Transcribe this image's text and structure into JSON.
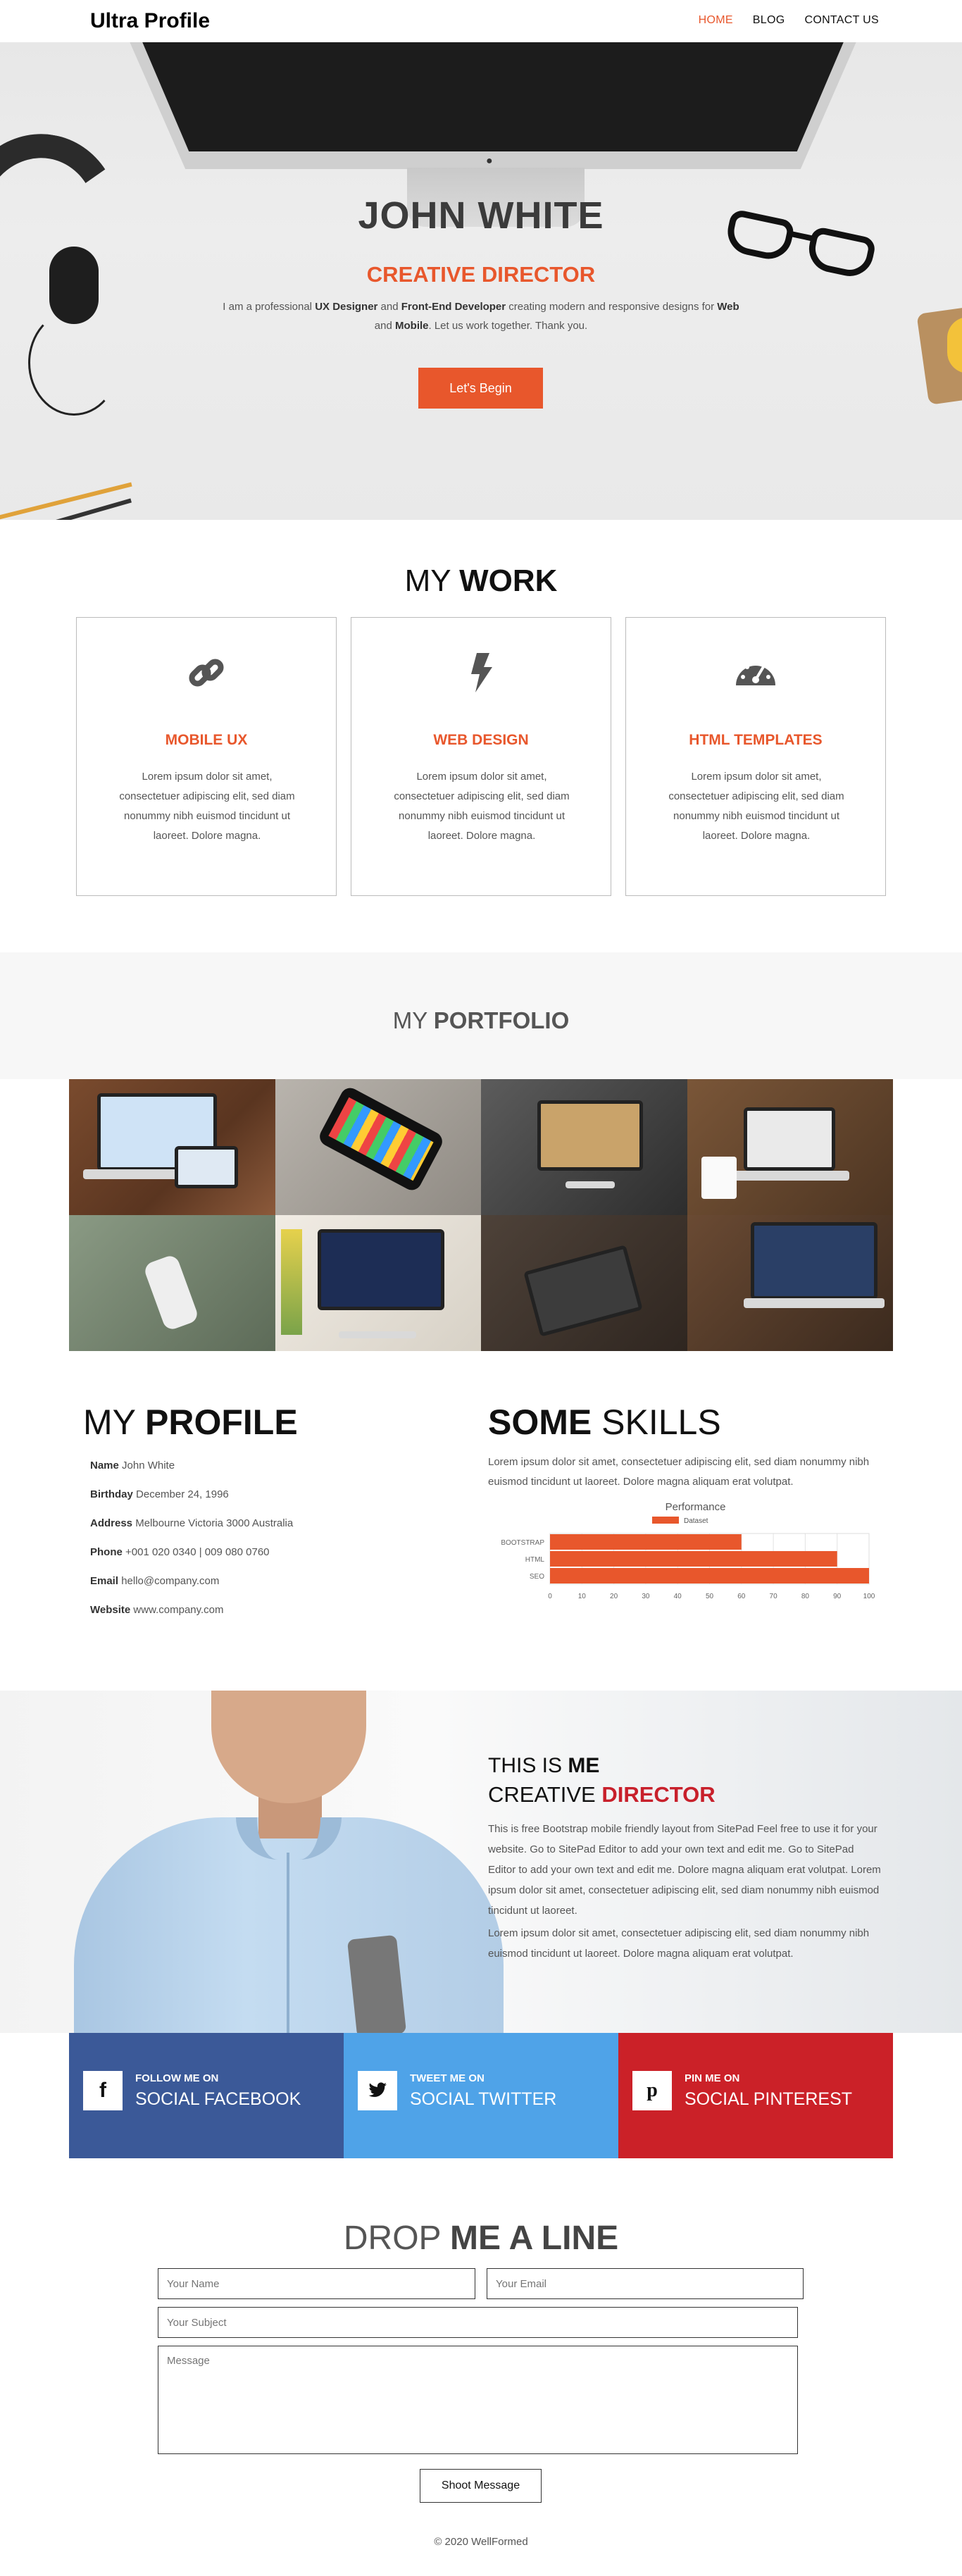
{
  "nav": {
    "brand": "Ultra Profile",
    "items": [
      {
        "label": "HOME",
        "active": true
      },
      {
        "label": "BLOG",
        "active": false
      },
      {
        "label": "CONTACT US",
        "active": false
      }
    ]
  },
  "hero": {
    "name": "JOHN WHITE",
    "role": "CREATIVE DIRECTOR",
    "desc": {
      "p1": "I am a professional ",
      "b1": "UX Designer",
      "p2": " and ",
      "b2": "Front-End Developer",
      "p3": " creating modern and responsive designs for ",
      "b3": "Web",
      "p4": " and ",
      "b4": "Mobile",
      "p5": ". Let us work together. Thank you."
    },
    "button": "Let's Begin"
  },
  "work": {
    "title_light": "MY ",
    "title_bold": "WORK",
    "cards": [
      {
        "icon": "link-icon",
        "title": "MOBILE UX",
        "text": "Lorem ipsum dolor sit amet, consectetuer adipiscing elit, sed diam nonummy nibh euismod tincidunt ut laoreet. Dolore magna."
      },
      {
        "icon": "bolt-icon",
        "title": "WEB DESIGN",
        "text": "Lorem ipsum dolor sit amet, consectetuer adipiscing elit, sed diam nonummy nibh euismod tincidunt ut laoreet. Dolore magna."
      },
      {
        "icon": "dashboard-icon",
        "title": "HTML TEMPLATES",
        "text": "Lorem ipsum dolor sit amet, consectetuer adipiscing elit, sed diam nonummy nibh euismod tincidunt ut laoreet. Dolore magna."
      }
    ]
  },
  "portfolio": {
    "title_light": "MY ",
    "title_bold": "PORTFOLIO"
  },
  "profile": {
    "title_light": "MY ",
    "title_bold": "PROFILE",
    "rows": [
      {
        "label": "Name",
        "value": "John White"
      },
      {
        "label": "Birthday",
        "value": "December 24, 1996"
      },
      {
        "label": "Address",
        "value": "Melbourne Victoria 3000 Australia"
      },
      {
        "label": "Phone",
        "value": "+001 020 0340 | 009 080 0760"
      },
      {
        "label": "Email",
        "value": "hello@company.com"
      },
      {
        "label": "Website",
        "value": "www.company.com"
      }
    ]
  },
  "skills": {
    "title_bold": "SOME",
    "title_light": " SKILLS",
    "desc": "Lorem ipsum dolor sit amet, consectetuer adipiscing elit, sed diam nonummy nibh euismod tincidunt ut laoreet. Dolore magna aliquam erat volutpat."
  },
  "chart_data": {
    "type": "bar",
    "orientation": "horizontal",
    "title": "Performance",
    "categories": [
      "BOOTSTRAP",
      "HTML",
      "SEO"
    ],
    "series": [
      {
        "name": "Dataset",
        "values": [
          60,
          90,
          100
        ]
      }
    ],
    "xlim": [
      0,
      100
    ],
    "xticks": [
      0,
      10,
      20,
      30,
      40,
      50,
      60,
      70,
      80,
      90,
      100
    ],
    "grid": true,
    "legend": "top",
    "color": "#e8572c"
  },
  "about": {
    "h1_light": "THIS IS ",
    "h1_bold": "ME",
    "h2_light": "CREATIVE ",
    "h2_bold": "DIRECTOR",
    "p1": "This is free Bootstrap mobile friendly layout from SitePad Feel free to use it for your website. Go to SitePad Editor to add your own text and edit me. Go to SitePad Editor to add your own text and edit me. Dolore magna aliquam erat volutpat. Lorem ipsum dolor sit amet, consectetuer adipiscing elit, sed diam nonummy nibh euismod tincidunt ut laoreet.",
    "p2": "Lorem ipsum dolor sit amet, consectetuer adipiscing elit, sed diam nonummy nibh euismod tincidunt ut laoreet. Dolore magna aliquam erat volutpat."
  },
  "social": [
    {
      "icon": "facebook-icon",
      "small": "FOLLOW ME ON",
      "big": "SOCIAL FACEBOOK",
      "color": "#3b5998"
    },
    {
      "icon": "twitter-icon",
      "small": "TWEET ME ON",
      "big": "SOCIAL TWITTER",
      "color": "#4fa3e8"
    },
    {
      "icon": "pinterest-icon",
      "small": "PIN ME ON",
      "big": "SOCIAL PINTEREST",
      "color": "#cb2128"
    }
  ],
  "contact": {
    "title_light": "DROP ",
    "title_bold": "ME A LINE",
    "name_placeholder": "Your Name",
    "email_placeholder": "Your Email",
    "subject_placeholder": "Your Subject",
    "message_placeholder": "Message",
    "button": "Shoot Message"
  },
  "footer": "© 2020 WellFormed",
  "colors": {
    "accent": "#e8572c",
    "red": "#c8202b"
  }
}
